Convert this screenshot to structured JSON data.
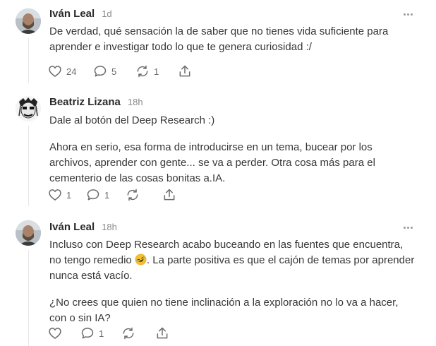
{
  "comments": [
    {
      "author": "Iván Leal",
      "time": "1d",
      "paragraphs": [
        "De verdad, qué sensación la de saber que no tienes vida suficiente para aprender e investigar todo lo que te genera curiosidad :/"
      ],
      "likes": "24",
      "replies": "5",
      "restacks": "1",
      "avatar_icon": "person-photo-avatar"
    },
    {
      "author": "Beatriz Lizana",
      "time": "18h",
      "paragraphs": [
        "Dale al botón del Deep Research :)",
        "Ahora en serio, esa forma de introducirse en un tema, bucear por los archivos, aprender con gente... se va a perder. Otra cosa más para el cementerio de las cosas bonitas a.IA."
      ],
      "likes": "1",
      "replies": "1",
      "restacks": "",
      "avatar_icon": "illustrated-face-avatar"
    },
    {
      "author": "Iván Leal",
      "time": "18h",
      "paragraphs_parts": {
        "p1_before": "Incluso con Deep Research acabo buceando en las fuentes que encuentra, no tengo remedio ",
        "p1_after": ". La parte positiva es que el cajón de temas por aprender nunca está vacío."
      },
      "paragraphs": [
        "¿No crees que quien no tiene inclinación a la exploración no lo va a hacer, con o sin IA?"
      ],
      "emoji": "rolling-on-floor-laughing-emoji",
      "likes": "",
      "replies": "1",
      "restacks": "",
      "avatar_icon": "person-photo-avatar"
    }
  ],
  "icons": {
    "like": "heart-icon",
    "reply": "comment-bubble-icon",
    "restack": "restack-arrows-icon",
    "share": "share-upload-icon",
    "more": "more-dots-icon"
  },
  "colors": {
    "text": "#363737",
    "muted": "#8a8a8a",
    "icon": "#6b6b6b",
    "divider": "#e6e6e6"
  }
}
